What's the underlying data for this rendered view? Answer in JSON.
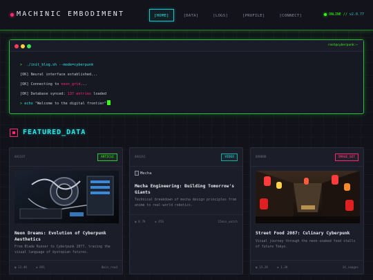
{
  "header": {
    "logo": "MACHINIC EMBODIMENT",
    "nav": [
      "[HOME]",
      "[DATA]",
      "[LOGS]",
      "[PROFILE]",
      "[CONNECT]"
    ],
    "status": "ONLINE",
    "version": "v2.0.77",
    "colors": {
      "accent_green": "#39ff14",
      "accent_cyan": "#2fe6e6",
      "accent_pink": "#ff2a6d"
    }
  },
  "terminal": {
    "title": "root@cyberpunk:~",
    "lines": {
      "l1_prompt": ">",
      "l1_cmd": "./init_blog.sh --mode=cyberpunk",
      "l2": "[OK] Neural interface established...",
      "l3_pre": "[OK] Connecting to ",
      "l3_hl": "neon_grid",
      "l3_post": "...",
      "l4_pre": "[OK] Database synced: ",
      "l4_hl": "137 entries",
      "l4_post": " loaded",
      "l5_prompt": ">",
      "l5_cmd": "echo",
      "l5_text": " \"Welcome to the digital frontier\""
    }
  },
  "section": {
    "title": "FEATURED_DATA",
    "icon": "square-target-icon"
  },
  "cards": [
    {
      "id": "0X1337",
      "badge": "ARTICLE",
      "title": "Neon Dreams: Evolution of Cyberpunk Aesthetics",
      "desc": "From Blade Runner to Cyberpunk 2077, tracing the visual language of dystopian futures.",
      "stat1": "◉ 12.4K",
      "stat2": "◈ 891",
      "right": "8min_read"
    },
    {
      "id": "0X42A1",
      "badge": "VIDEO",
      "image_alt": "Mecha",
      "title": "Mecha Engineering: Building Tomorrow's Giants",
      "desc": "Technical breakdown of mecha design principles from anime to real-world robotics.",
      "stat1": "◉ 8.7K",
      "stat2": "◈ 456",
      "right": "15min_watch"
    },
    {
      "id": "0X8080",
      "badge": "IMAGE_SET",
      "title": "Street Food 2087: Culinary Cyberpunk",
      "desc": "Visual journey through the neon-soaked food stalls of future Tokyo.",
      "stat1": "◉ 15.2K",
      "stat2": "◈ 1.2K",
      "right": "24_images"
    }
  ]
}
